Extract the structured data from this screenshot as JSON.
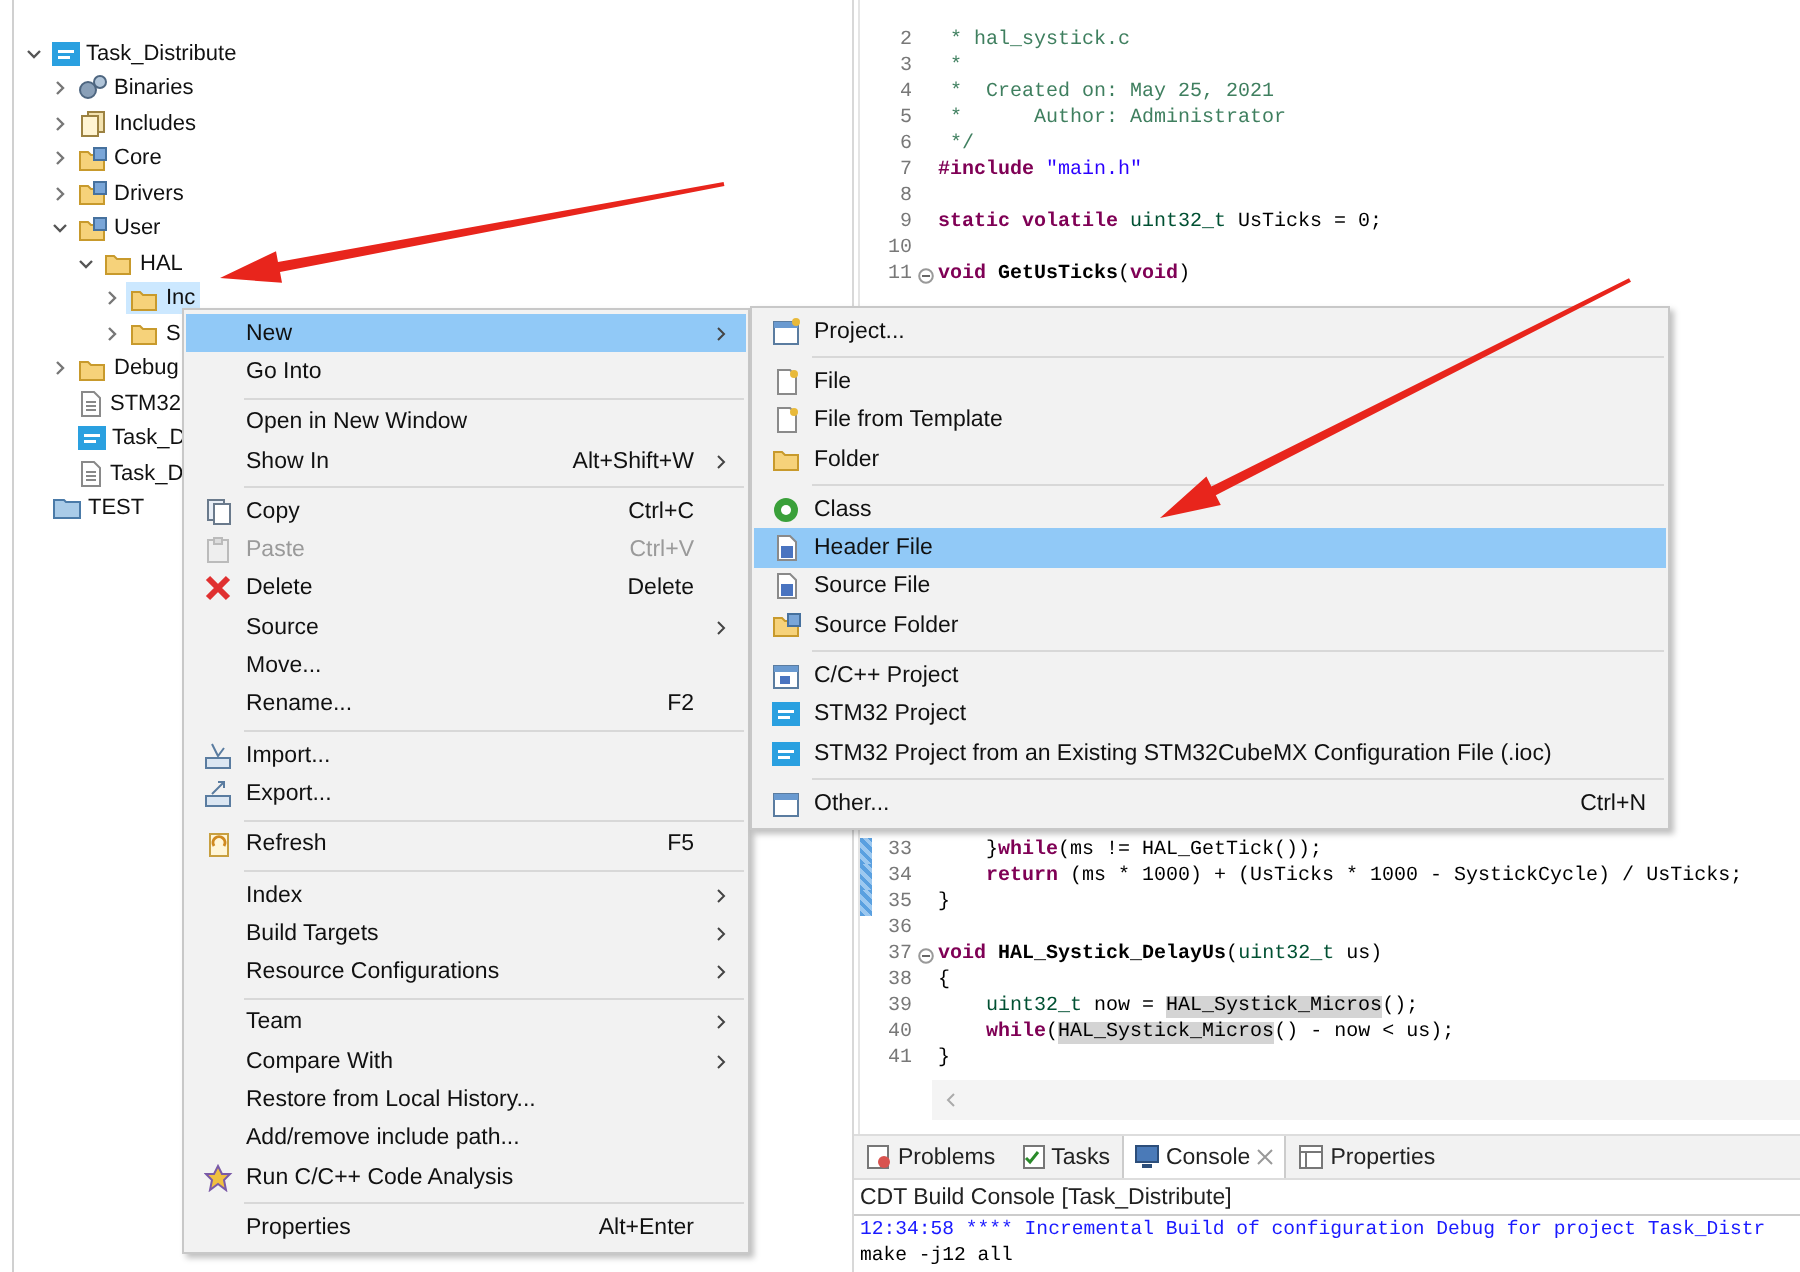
{
  "project_tree": [
    {
      "label": "Task_Distribute",
      "kind": "project",
      "expanded": true,
      "selected": false,
      "children": [
        {
          "label": "Binaries",
          "kind": "binaries",
          "expanded": false,
          "selected": false
        },
        {
          "label": "Includes",
          "kind": "includes",
          "expanded": false,
          "selected": false
        },
        {
          "label": "Core",
          "kind": "source-folder",
          "expanded": false,
          "selected": false
        },
        {
          "label": "Drivers",
          "kind": "source-folder",
          "expanded": false,
          "selected": false
        },
        {
          "label": "User",
          "kind": "source-folder",
          "expanded": true,
          "selected": false,
          "children": [
            {
              "label": "HAL",
              "kind": "folder",
              "expanded": true,
              "selected": false,
              "children": [
                {
                  "label": "Inc",
                  "kind": "folder",
                  "expanded": false,
                  "selected": true
                },
                {
                  "label": "S",
                  "kind": "folder",
                  "expanded": false,
                  "selected": false
                }
              ]
            }
          ]
        },
        {
          "label": "Debug",
          "kind": "folder",
          "expanded": false,
          "selected": false
        },
        {
          "label": "STM32",
          "kind": "linker-file",
          "selected": false
        },
        {
          "label": "Task_D",
          "kind": "mx-file",
          "selected": false
        },
        {
          "label": "Task_D",
          "kind": "file",
          "selected": false
        }
      ]
    },
    {
      "label": "TEST",
      "kind": "working-set",
      "selected": false
    }
  ],
  "editor": {
    "top_lines": [
      {
        "number": "2",
        "foldable": false,
        "changed": false,
        "tokens": [
          {
            "kind": "comment",
            "text": " * hal_systick.c"
          }
        ]
      },
      {
        "number": "3",
        "foldable": false,
        "changed": false,
        "tokens": [
          {
            "kind": "comment",
            "text": " *"
          }
        ]
      },
      {
        "number": "4",
        "foldable": false,
        "changed": false,
        "tokens": [
          {
            "kind": "comment",
            "text": " *  Created on: May 25, 2021"
          }
        ]
      },
      {
        "number": "5",
        "foldable": false,
        "changed": false,
        "tokens": [
          {
            "kind": "comment",
            "text": " *      Author: Administrator"
          }
        ]
      },
      {
        "number": "6",
        "foldable": false,
        "changed": false,
        "tokens": [
          {
            "kind": "comment",
            "text": " */"
          }
        ]
      },
      {
        "number": "7",
        "foldable": false,
        "changed": false,
        "tokens": [
          {
            "kind": "directive",
            "text": "#include"
          },
          {
            "kind": "string",
            "text": " \"main.h\""
          }
        ]
      },
      {
        "number": "8",
        "foldable": false,
        "changed": false
      },
      {
        "number": "9",
        "foldable": false,
        "changed": false,
        "tokens": [
          {
            "kind": "keyword",
            "text": "static volatile"
          },
          {
            "kind": "type",
            "text": " uint32_t"
          },
          {
            "kind": "plain",
            "text": " UsTicks = 0;"
          }
        ]
      },
      {
        "number": "10",
        "foldable": false,
        "changed": false
      },
      {
        "number": "11",
        "foldable": true,
        "changed": false,
        "tokens": [
          {
            "kind": "keyword",
            "text": "void"
          },
          {
            "kind": "function",
            "text": " GetUsTicks"
          },
          {
            "kind": "plain",
            "text": "("
          },
          {
            "kind": "keyword",
            "text": "void"
          },
          {
            "kind": "plain",
            "text": ")"
          }
        ]
      }
    ],
    "bottom_lines": [
      {
        "number": "33",
        "foldable": false,
        "changed": true,
        "tokens": [
          {
            "kind": "plain",
            "text": "    }"
          },
          {
            "kind": "keyword",
            "text": "while"
          },
          {
            "kind": "plain",
            "text": "(ms != HAL_GetTick());"
          }
        ]
      },
      {
        "number": "34",
        "foldable": false,
        "changed": true,
        "tokens": [
          {
            "kind": "keyword",
            "text": "    return"
          },
          {
            "kind": "plain",
            "text": " (ms * 1000) + (UsTicks * 1000 - SystickCycle) / UsTicks;"
          }
        ]
      },
      {
        "number": "35",
        "foldable": false,
        "changed": true,
        "tokens": [
          {
            "kind": "plain",
            "text": "}"
          }
        ]
      },
      {
        "number": "36",
        "foldable": false,
        "changed": false
      },
      {
        "number": "37",
        "foldable": true,
        "changed": false,
        "tokens": [
          {
            "kind": "keyword",
            "text": "void"
          },
          {
            "kind": "function",
            "text": " HAL_Systick_DelayUs"
          },
          {
            "kind": "plain",
            "text": "("
          },
          {
            "kind": "type",
            "text": "uint32_t"
          },
          {
            "kind": "plain",
            "text": " us)"
          }
        ]
      },
      {
        "number": "38",
        "foldable": false,
        "changed": false,
        "tokens": [
          {
            "kind": "plain",
            "text": "{"
          }
        ]
      },
      {
        "number": "39",
        "foldable": false,
        "changed": false,
        "tokens": [
          {
            "kind": "type",
            "text": "    uint32_t"
          },
          {
            "kind": "plain",
            "text": " now = "
          },
          {
            "kind": "occurrence",
            "text": "HAL_Systick_Micros"
          },
          {
            "kind": "plain",
            "text": "();"
          }
        ]
      },
      {
        "number": "40",
        "foldable": false,
        "changed": false,
        "tokens": [
          {
            "kind": "keyword",
            "text": "    while"
          },
          {
            "kind": "plain",
            "text": "("
          },
          {
            "kind": "occurrence",
            "text": "HAL_Systick_Micros"
          },
          {
            "kind": "plain",
            "text": "() - now < us);"
          }
        ]
      },
      {
        "number": "41",
        "foldable": false,
        "changed": false,
        "tokens": [
          {
            "kind": "plain",
            "text": "}"
          }
        ]
      }
    ]
  },
  "console": {
    "tabs": [
      {
        "label": "Problems",
        "selected": false
      },
      {
        "label": "Tasks",
        "selected": false
      },
      {
        "label": "Console",
        "selected": true
      },
      {
        "label": "Properties",
        "selected": false
      }
    ],
    "title": "CDT Build Console [Task_Distribute]",
    "lines": [
      {
        "kind": "info",
        "text": "12:34:58 **** Incremental Build of configuration Debug for project Task_Distr"
      },
      {
        "kind": "output",
        "text": "make -j12 all"
      }
    ]
  },
  "context_menu": {
    "items": [
      {
        "kind": "item",
        "label": "New",
        "submenu": true,
        "selected": true,
        "disabled": false
      },
      {
        "kind": "item",
        "label": "Go Into",
        "submenu": false,
        "selected": false,
        "disabled": false
      },
      {
        "kind": "separator"
      },
      {
        "kind": "item",
        "label": "Open in New Window",
        "submenu": false,
        "selected": false,
        "disabled": false
      },
      {
        "kind": "item",
        "label": "Show In",
        "shortcut": "Alt+Shift+W",
        "submenu": true,
        "selected": false,
        "disabled": false
      },
      {
        "kind": "separator"
      },
      {
        "kind": "item",
        "label": "Copy",
        "shortcut": "Ctrl+C",
        "submenu": false,
        "selected": false,
        "disabled": false
      },
      {
        "kind": "item",
        "label": "Paste",
        "shortcut": "Ctrl+V",
        "submenu": false,
        "selected": false,
        "disabled": true
      },
      {
        "kind": "item",
        "label": "Delete",
        "shortcut": "Delete",
        "submenu": false,
        "selected": false,
        "disabled": false
      },
      {
        "kind": "item",
        "label": "Source",
        "submenu": true,
        "selected": false,
        "disabled": false
      },
      {
        "kind": "item",
        "label": "Move...",
        "submenu": false,
        "selected": false,
        "disabled": false
      },
      {
        "kind": "item",
        "label": "Rename...",
        "shortcut": "F2",
        "submenu": false,
        "selected": false,
        "disabled": false
      },
      {
        "kind": "separator"
      },
      {
        "kind": "item",
        "label": "Import...",
        "submenu": false,
        "selected": false,
        "disabled": false
      },
      {
        "kind": "item",
        "label": "Export...",
        "submenu": false,
        "selected": false,
        "disabled": false
      },
      {
        "kind": "separator"
      },
      {
        "kind": "item",
        "label": "Refresh",
        "shortcut": "F5",
        "submenu": false,
        "selected": false,
        "disabled": false
      },
      {
        "kind": "separator"
      },
      {
        "kind": "item",
        "label": "Index",
        "submenu": true,
        "selected": false,
        "disabled": false
      },
      {
        "kind": "item",
        "label": "Build Targets",
        "submenu": true,
        "selected": false,
        "disabled": false
      },
      {
        "kind": "item",
        "label": "Resource Configurations",
        "submenu": true,
        "selected": false,
        "disabled": false
      },
      {
        "kind": "separator"
      },
      {
        "kind": "item",
        "label": "Team",
        "submenu": true,
        "selected": false,
        "disabled": false
      },
      {
        "kind": "item",
        "label": "Compare With",
        "submenu": true,
        "selected": false,
        "disabled": false
      },
      {
        "kind": "item",
        "label": "Restore from Local History...",
        "submenu": false,
        "selected": false,
        "disabled": false
      },
      {
        "kind": "item",
        "label": "Add/remove include path...",
        "submenu": false,
        "selected": false,
        "disabled": false
      },
      {
        "kind": "item",
        "label": "Run C/C++ Code Analysis",
        "submenu": false,
        "selected": false,
        "disabled": false
      },
      {
        "kind": "separator"
      },
      {
        "kind": "item",
        "label": "Properties",
        "shortcut": "Alt+Enter",
        "submenu": false,
        "selected": false,
        "disabled": false
      }
    ]
  },
  "new_submenu": {
    "items": [
      {
        "kind": "item",
        "label": "Project...",
        "selected": false
      },
      {
        "kind": "separator"
      },
      {
        "kind": "item",
        "label": "File",
        "selected": false
      },
      {
        "kind": "item",
        "label": "File from Template",
        "selected": false
      },
      {
        "kind": "item",
        "label": "Folder",
        "selected": false
      },
      {
        "kind": "separator"
      },
      {
        "kind": "item",
        "label": "Class",
        "selected": false
      },
      {
        "kind": "item",
        "label": "Header File",
        "selected": true
      },
      {
        "kind": "item",
        "label": "Source File",
        "selected": false
      },
      {
        "kind": "item",
        "label": "Source Folder",
        "selected": false
      },
      {
        "kind": "separator"
      },
      {
        "kind": "item",
        "label": "C/C++ Project",
        "selected": false
      },
      {
        "kind": "item",
        "label": "STM32 Project",
        "selected": false
      },
      {
        "kind": "item",
        "label": "STM32 Project from an Existing STM32CubeMX Configuration File (.ioc)",
        "selected": false
      },
      {
        "kind": "separator"
      },
      {
        "kind": "item",
        "label": "Other...",
        "shortcut": "Ctrl+N",
        "selected": false
      }
    ]
  }
}
